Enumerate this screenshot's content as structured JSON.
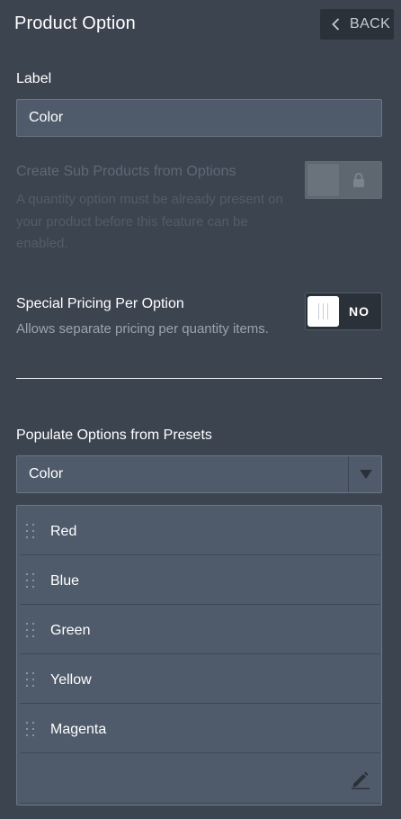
{
  "header": {
    "title": "Product Option",
    "back_label": "BACK"
  },
  "label_field": {
    "title": "Label",
    "value": "Color"
  },
  "sub_products": {
    "title": "Create Sub Products from Options",
    "description": "A quantity option must be already present on your product before this feature can be enabled.",
    "locked": true
  },
  "special_pricing": {
    "title": "Special Pricing Per Option",
    "description": "Allows separate pricing per quantity items.",
    "state": "NO"
  },
  "presets": {
    "title": "Populate Options from Presets",
    "selected": "Color"
  },
  "options": {
    "items": [
      {
        "label": "Red"
      },
      {
        "label": "Blue"
      },
      {
        "label": "Green"
      },
      {
        "label": "Yellow"
      },
      {
        "label": "Magenta"
      }
    ]
  },
  "colors": {
    "background": "#3c4450",
    "field_bg": "#4f5b6b",
    "field_border": "#6a7585",
    "button_dark": "#2b3139",
    "disabled_text": "#5f6876"
  },
  "icons": {
    "back": "chevron-left-icon",
    "lock": "lock-icon",
    "dropdown": "caret-down-icon",
    "drag": "drag-handle-icon",
    "edit": "pencil-icon"
  }
}
